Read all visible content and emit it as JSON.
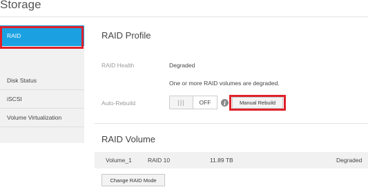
{
  "page": {
    "title": "Storage"
  },
  "sidebar": {
    "items": [
      {
        "label": "RAID",
        "active": true
      },
      {
        "label": "Disk Status",
        "active": false
      },
      {
        "label": "iSCSI",
        "active": false
      },
      {
        "label": "Volume Virtualization",
        "active": false
      }
    ]
  },
  "raid_profile": {
    "title": "RAID Profile",
    "health_label": "RAID Health",
    "health_value": "Degraded",
    "health_message": "One or more RAID volumes are degraded.",
    "auto_rebuild_label": "Auto-Rebuild",
    "toggle_knob": "|||",
    "toggle_state": "OFF",
    "info_icon": "info-icon",
    "manual_rebuild_label": "Manual Rebuild"
  },
  "raid_volume": {
    "title": "RAID Volume",
    "rows": [
      {
        "name": "Volume_1",
        "level": "RAID 10",
        "size": "11.89 TB",
        "status": "Degraded"
      }
    ],
    "change_mode_label": "Change RAID Mode"
  },
  "colors": {
    "accent": "#1ba1e2",
    "highlight": "#e0202a",
    "sidebar_bg": "#f1f1f1"
  }
}
